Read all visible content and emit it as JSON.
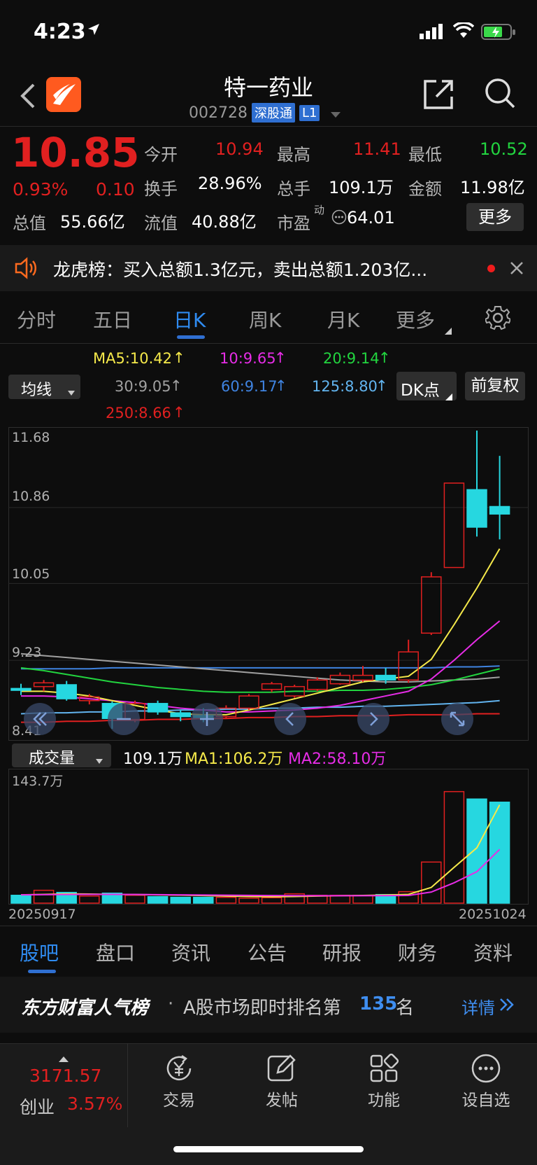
{
  "status": {
    "time": "4:23"
  },
  "header": {
    "stock_name": "特一药业",
    "code": "002728",
    "market_tag": "深股通",
    "level_tag": "L1"
  },
  "quote": {
    "price": "10.85",
    "change_pct": "0.93%",
    "change_amt": "0.10",
    "open_label": "今开",
    "open": "10.94",
    "high_label": "最高",
    "high": "11.41",
    "low_label": "最低",
    "low": "10.52",
    "turnover_label": "换手",
    "turnover": "28.96%",
    "volume_label": "总手",
    "volume": "109.1万",
    "amount_label": "金额",
    "amount": "11.98亿",
    "mktcap_label": "总值",
    "mktcap": "55.66亿",
    "float_label": "流值",
    "float_cap": "40.88亿",
    "pe_label": "市盈",
    "pe_sup": "动",
    "pe": "64.01",
    "more_label": "更多"
  },
  "notice": {
    "text": "龙虎榜：买入总额1.3亿元，卖出总额1.203亿..."
  },
  "chart_tabs": [
    "分时",
    "五日",
    "日K",
    "周K",
    "月K",
    "更多"
  ],
  "ma_panel": {
    "selector": "均线",
    "ma5": "MA5:10.42",
    "ma10": "10:9.65",
    "ma20": "20:9.14",
    "ma30": "30:9.05",
    "ma60": "60:9.17",
    "ma125": "125:8.80",
    "ma250": "250:8.66",
    "dk_label": "DK点",
    "adjust_label": "前复权"
  },
  "price_axis": [
    "11.68",
    "10.86",
    "10.05",
    "9.23",
    "8.41"
  ],
  "volume_panel": {
    "selector": "成交量",
    "vol": "109.1万",
    "ma1": "MA1:106.2万",
    "ma2": "MA2:58.10万",
    "axis_max": "143.7万",
    "date_start": "20250917",
    "date_end": "20251024"
  },
  "chart_data": {
    "type": "candlestick",
    "ylim": [
      8.41,
      11.68
    ],
    "candles": [
      {
        "o": 8.93,
        "c": 8.91,
        "h": 8.98,
        "l": 8.86
      },
      {
        "o": 8.95,
        "c": 8.99,
        "h": 9.02,
        "l": 8.9
      },
      {
        "o": 8.97,
        "c": 8.82,
        "h": 9.01,
        "l": 8.8
      },
      {
        "o": 8.8,
        "c": 8.84,
        "h": 8.87,
        "l": 8.76
      },
      {
        "o": 8.77,
        "c": 8.61,
        "h": 8.79,
        "l": 8.5
      },
      {
        "o": 8.6,
        "c": 8.77,
        "h": 8.8,
        "l": 8.57
      },
      {
        "o": 8.77,
        "c": 8.68,
        "h": 8.8,
        "l": 8.65
      },
      {
        "o": 8.67,
        "c": 8.63,
        "h": 8.7,
        "l": 8.58
      },
      {
        "o": 8.64,
        "c": 8.62,
        "h": 8.72,
        "l": 8.57
      },
      {
        "o": 8.63,
        "c": 8.72,
        "h": 8.75,
        "l": 8.61
      },
      {
        "o": 8.72,
        "c": 8.85,
        "h": 8.87,
        "l": 8.7
      },
      {
        "o": 8.92,
        "c": 8.98,
        "h": 9.0,
        "l": 8.89
      },
      {
        "o": 8.85,
        "c": 8.95,
        "h": 8.97,
        "l": 8.83
      },
      {
        "o": 8.92,
        "c": 9.02,
        "h": 9.05,
        "l": 8.9
      },
      {
        "o": 8.98,
        "c": 9.07,
        "h": 9.1,
        "l": 8.97
      },
      {
        "o": 9.02,
        "c": 9.07,
        "h": 9.17,
        "l": 9.0
      },
      {
        "o": 9.07,
        "c": 9.02,
        "h": 9.15,
        "l": 8.98
      },
      {
        "o": 9.02,
        "c": 9.32,
        "h": 9.45,
        "l": 8.99
      },
      {
        "o": 9.52,
        "c": 10.12,
        "h": 10.17,
        "l": 9.5
      },
      {
        "o": 10.22,
        "c": 11.12,
        "h": 11.12,
        "l": 10.22
      },
      {
        "o": 11.05,
        "c": 10.65,
        "h": 11.68,
        "l": 10.55
      },
      {
        "o": 10.87,
        "c": 10.79,
        "h": 11.41,
        "l": 10.52
      }
    ],
    "ma5": [
      8.9,
      8.9,
      8.88,
      8.85,
      8.8,
      8.75,
      8.7,
      8.66,
      8.65,
      8.65,
      8.7,
      8.76,
      8.82,
      8.88,
      8.94,
      9.0,
      9.03,
      9.06,
      9.24,
      9.61,
      10.0,
      10.42
    ],
    "ma10": [
      8.85,
      8.85,
      8.84,
      8.82,
      8.8,
      8.78,
      8.75,
      8.72,
      8.7,
      8.68,
      8.68,
      8.69,
      8.7,
      8.72,
      8.75,
      8.8,
      8.85,
      8.9,
      9.03,
      9.23,
      9.45,
      9.65
    ],
    "ma20": [
      9.15,
      9.12,
      9.08,
      9.04,
      9.0,
      8.97,
      8.94,
      8.92,
      8.9,
      8.89,
      8.89,
      8.89,
      8.9,
      8.9,
      8.91,
      8.91,
      8.92,
      8.94,
      8.97,
      9.02,
      9.08,
      9.14
    ],
    "ma30": [
      9.3,
      9.28,
      9.26,
      9.24,
      9.22,
      9.2,
      9.18,
      9.16,
      9.14,
      9.12,
      9.1,
      9.08,
      9.06,
      9.04,
      9.02,
      9.01,
      9.0,
      9.0,
      9.01,
      9.02,
      9.03,
      9.05
    ],
    "ma60": [
      9.14,
      9.14,
      9.14,
      9.14,
      9.15,
      9.15,
      9.15,
      9.15,
      9.15,
      9.15,
      9.15,
      9.15,
      9.15,
      9.15,
      9.15,
      9.15,
      9.15,
      9.15,
      9.15,
      9.16,
      9.16,
      9.17
    ],
    "ma125": [
      8.66,
      8.67,
      8.67,
      8.68,
      8.68,
      8.69,
      8.69,
      8.7,
      8.7,
      8.71,
      8.71,
      8.72,
      8.72,
      8.73,
      8.73,
      8.74,
      8.74,
      8.75,
      8.76,
      8.77,
      8.78,
      8.8
    ],
    "ma250": [
      8.57,
      8.57,
      8.58,
      8.58,
      8.59,
      8.59,
      8.6,
      8.6,
      8.61,
      8.61,
      8.62,
      8.62,
      8.63,
      8.63,
      8.64,
      8.64,
      8.64,
      8.65,
      8.65,
      8.65,
      8.66,
      8.66
    ],
    "volume_ylim": [
      0,
      143.7
    ],
    "volume": [
      8.5,
      13.9,
      11.6,
      7.7,
      10.8,
      8.5,
      7.0,
      6.3,
      6.3,
      6.3,
      5.4,
      5.9,
      10.1,
      8.5,
      8.5,
      8.5,
      9.3,
      12.4,
      44.4,
      120.5,
      112.5,
      109.1
    ],
    "vol_ma1": [
      9,
      9.5,
      10,
      9.8,
      9.5,
      9.4,
      9.0,
      8.7,
      8.2,
      7.7,
      7.2,
      6.9,
      7.2,
      7.7,
      8.0,
      8.3,
      8.8,
      9.5,
      17.0,
      38.7,
      59.8,
      106.2
    ],
    "vol_ma2": [
      9,
      9.2,
      9.4,
      9.5,
      9.5,
      9.4,
      9.2,
      9.0,
      8.8,
      8.6,
      8.4,
      8.2,
      8.1,
      8.0,
      8.0,
      8.0,
      8.1,
      8.3,
      12.0,
      22.0,
      34.0,
      58.1
    ]
  },
  "bottom_tabs": [
    "股吧",
    "盘口",
    "资讯",
    "公告",
    "研报",
    "财务",
    "资料"
  ],
  "popularity": {
    "brand": "东方财富人气榜",
    "prefix": "A股市场即时排名第",
    "rank": "135",
    "suffix": "名",
    "detail": "详情"
  },
  "bottom_nav": {
    "index_value": "3171.57",
    "index_name": "创业",
    "index_change": "3.57%",
    "items": [
      "交易",
      "发帖",
      "功能",
      "设自选"
    ]
  },
  "colors": {
    "up": "#e12020",
    "down": "#26d7e0",
    "accent": "#2f6fd1",
    "ma5": "#f5e94a",
    "ma10": "#e62ce6",
    "ma20": "#22d43f",
    "ma30": "#a0a0a0",
    "ma60": "#3f83e0",
    "ma125": "#62b4ef",
    "ma250": "#e12020"
  }
}
